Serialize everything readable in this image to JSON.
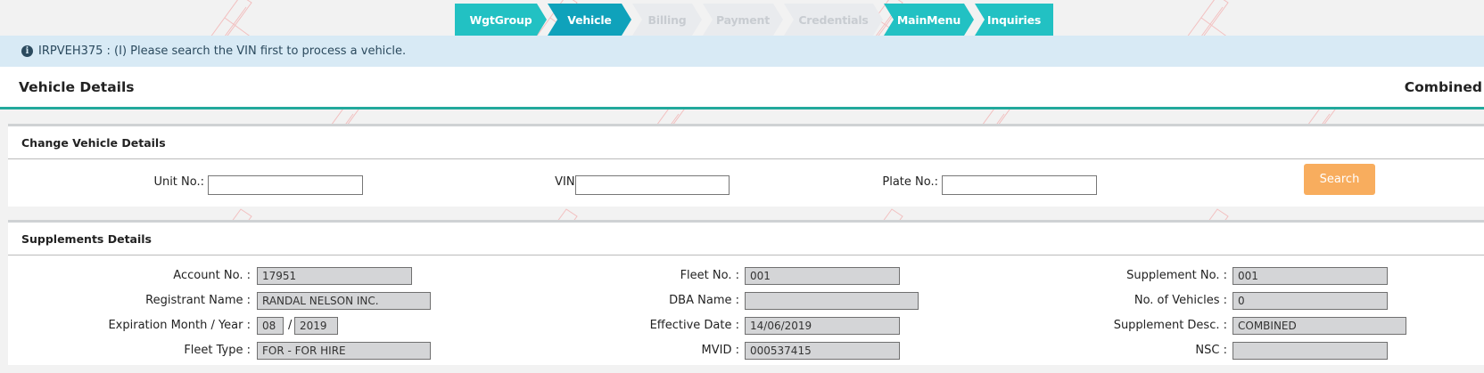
{
  "stepper": {
    "steps": [
      {
        "label": "WgtGroup",
        "state": "done"
      },
      {
        "label": "Vehicle",
        "state": "active"
      },
      {
        "label": "Billing",
        "state": "disabled"
      },
      {
        "label": "Payment",
        "state": "disabled"
      },
      {
        "label": "Credentials",
        "state": "disabled"
      },
      {
        "label": "MainMenu",
        "state": "done"
      },
      {
        "label": "Inquiries",
        "state": "done"
      }
    ]
  },
  "info": {
    "icon": "info-circle-icon",
    "message": "IRPVEH375 : (I) Please search the VIN first to process a vehicle."
  },
  "header": {
    "title": "Vehicle Details",
    "mode": "Combined"
  },
  "change_vehicle": {
    "title": "Change Vehicle Details",
    "unit_label": "Unit No.:",
    "unit_value": "",
    "vin_label": "VIN:",
    "vin_value": "",
    "plate_label": "Plate No.:",
    "plate_value": "",
    "search_label": "Search"
  },
  "supplements": {
    "title": "Supplements Details",
    "account_label": "Account No. :",
    "account_value": "17951",
    "registrant_label": "Registrant Name :",
    "registrant_value": "RANDAL NELSON INC.",
    "expiration_label": "Expiration Month / Year :",
    "expiration_month": "08",
    "expiration_sep": "/",
    "expiration_year": "2019",
    "fleet_type_label": "Fleet Type :",
    "fleet_type_value": "FOR - FOR HIRE",
    "fleet_no_label": "Fleet No. :",
    "fleet_no_value": "001",
    "dba_label": "DBA Name :",
    "dba_value": "",
    "effective_label": "Effective Date :",
    "effective_value": "14/06/2019",
    "mvid_label": "MVID :",
    "mvid_value": "000537415",
    "supplement_no_label": "Supplement No. :",
    "supplement_no_value": "001",
    "vehicles_label": "No. of Vehicles :",
    "vehicles_value": "0",
    "supp_desc_label": "Supplement Desc. :",
    "supp_desc_value": "COMBINED",
    "nsc_label": "NSC :",
    "nsc_value": ""
  },
  "colors": {
    "step_teal": "#22c1c3",
    "step_active": "#0fa2bb",
    "step_disabled": "#e9ebee",
    "info_bg": "#d8eaf5",
    "title_underline": "#22a99c",
    "search_button": "#f8ad5e"
  }
}
